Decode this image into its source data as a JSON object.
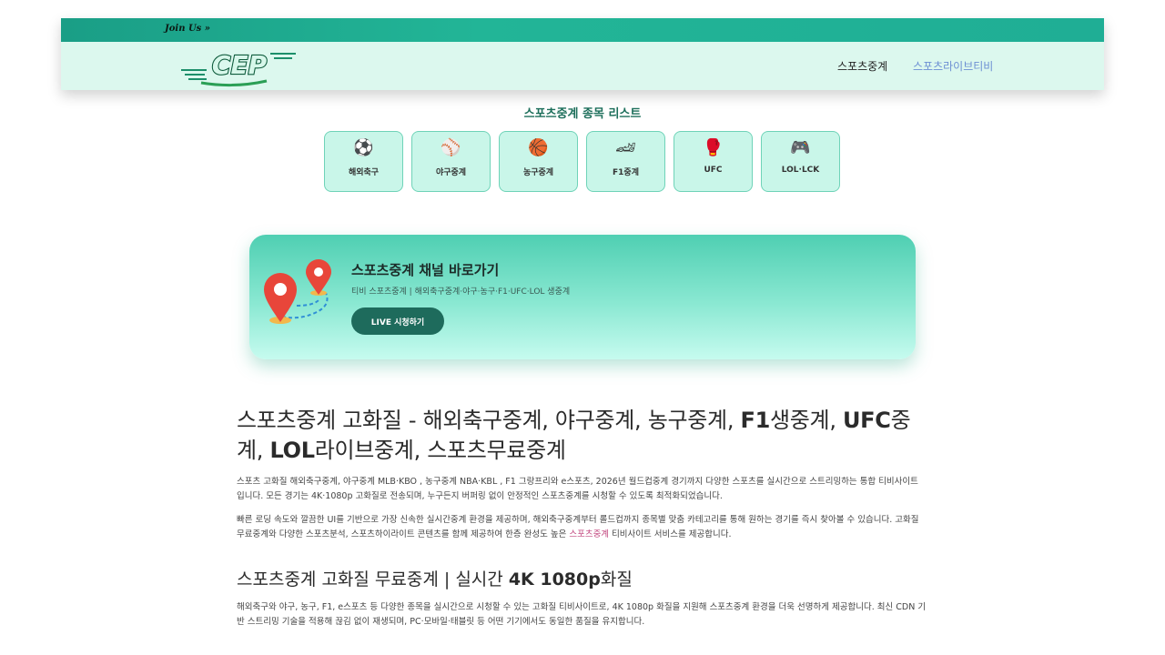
{
  "header": {
    "join_us": "Join Us »",
    "logo_text": "CEP",
    "nav": [
      "스포츠중계",
      "스포츠라이브티비"
    ]
  },
  "sports": {
    "title": "스포츠중계 종목 리스트",
    "items": [
      {
        "icon": "soccer-ball-icon",
        "glyph": "⚽",
        "label": "해외축구"
      },
      {
        "icon": "baseball-icon",
        "glyph": "⚾",
        "label": "야구중계"
      },
      {
        "icon": "basketball-icon",
        "glyph": "🏀",
        "label": "농구중계"
      },
      {
        "icon": "race-car-icon",
        "glyph": "🏎",
        "label": "F1중계"
      },
      {
        "icon": "boxing-glove-icon",
        "glyph": "🥊",
        "label": "UFC"
      },
      {
        "icon": "game-controller-icon",
        "glyph": "🎮",
        "label": "LOL·LCK"
      }
    ]
  },
  "banner": {
    "title": "스포츠중계 채널 바로가기",
    "subtitle": "티비 스포츠중계 | 해외축구중계·야구·농구·F1·UFC·LOL 생중계",
    "button": "LIVE 시청하기"
  },
  "article": {
    "h1_parts": [
      "스포츠중계 고화질 - 해외축구중계, 야구중계, 농구중계, ",
      "F1",
      "생중계, ",
      "UFC",
      "중계, ",
      "LOL",
      "라이브중계, 스포츠무료중계"
    ],
    "p1": "스포츠 고화질 해외축구중계, 야구중계 MLB·KBO , 농구중계 NBA·KBL , F1 그랑프리와 e스포츠, 2026년 월드컵중계 경기까지 다양한 스포츠를 실시간으로 스트리밍하는 통합 티비사이트 입니다. 모든 경기는 4K·1080p 고화질로 전송되며, 누구든지 버퍼링 없이 안정적인 스포츠중계를 시청할 수 있도록 최적화되었습니다.",
    "p2_before": "빠른 로딩 속도와 깔끔한 UI를 기반으로 가장 신속한 실시간중계 환경을 제공하며, 해외축구중계부터 롤드컵까지 종목별 맞춤 카테고리를 통해 원하는 경기를 즉시 찾아볼 수 있습니다. 고화질 무료중계와 다양한 스포츠분석, 스포츠하이라이트 콘텐츠를 함께 제공하여 한층 완성도 높은 ",
    "p2_link": "스포츠중계",
    "p2_after": " 티비사이트 서비스를 제공합니다.",
    "h2_parts": [
      "스포츠중계 고화질 무료중계 | 실시간 ",
      "4K 1080p",
      "화질"
    ],
    "p3": "해외축구와 야구, 농구, F1, e스포츠 등 다양한 종목을 실시간으로 시청할 수 있는 고화질 티비사이트로, 4K 1080p 화질을 지원해 스포츠중계 환경을 더욱 선명하게 제공합니다. 최신 CDN 기반 스트리밍 기술을 적용해 끊김 없이 재생되며, PC·모바일·태블릿 등 어떤 기기에서도 동일한 품질을 유지합니다."
  },
  "colors": {
    "topbar": "#1fae95",
    "navbar_bg": "#dcf8ee",
    "card_bg": "#c9f6e9",
    "button_bg": "#1e6b5c",
    "link": "#c2467e"
  }
}
